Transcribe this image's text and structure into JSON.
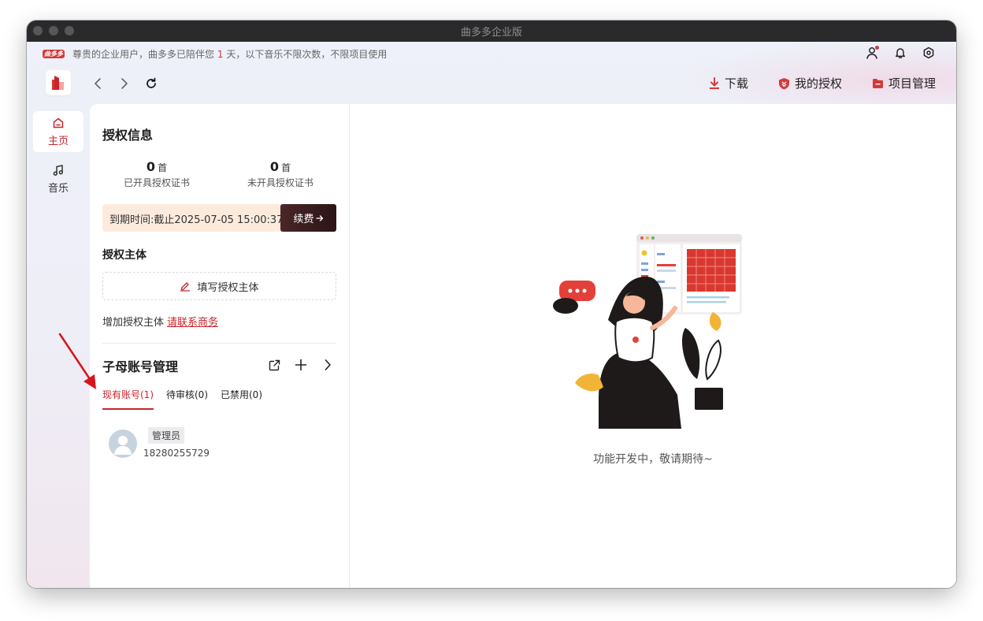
{
  "window": {
    "title": "曲多多企业版"
  },
  "notice": {
    "brand": "曲多多",
    "prefix": "尊贵的企业用户，曲多多已陪伴您",
    "days": "1",
    "suffix": "天，以下音乐不限次数，不限项目使用"
  },
  "top_icons": [
    "user-icon",
    "bell-icon",
    "settings-icon"
  ],
  "toolbar": {
    "download_label": "下载",
    "my_license_label": "我的授权",
    "project_label": "项目管理"
  },
  "sidebar": {
    "items": [
      {
        "label": "主页",
        "icon": "home-icon",
        "active": true
      },
      {
        "label": "音乐",
        "icon": "music-note-icon",
        "active": false
      }
    ]
  },
  "license_info": {
    "title": "授权信息",
    "stats": [
      {
        "value": "0",
        "unit": "首",
        "label": "已开具授权证书"
      },
      {
        "value": "0",
        "unit": "首",
        "label": "未开具授权证书"
      }
    ],
    "expiry_text": "到期时间:截止2025-07-05 15:00:37",
    "renew_label": "续费"
  },
  "license_subject": {
    "title": "授权主体",
    "fill_label": "填写授权主体",
    "add_text": "增加授权主体",
    "contact_link": "请联系商务"
  },
  "accounts": {
    "title": "子母账号管理",
    "tabs": [
      {
        "label": "现有账号(1)",
        "active": true
      },
      {
        "label": "待审核(0)",
        "active": false
      },
      {
        "label": "已禁用(0)",
        "active": false
      }
    ],
    "members": [
      {
        "role": "管理员",
        "phone": "18280255729"
      }
    ]
  },
  "main": {
    "empty_text": "功能开发中，敬请期待~"
  },
  "colors": {
    "accent": "#c8242b",
    "renew_dark": "#2b1416",
    "expiry_bg": "#fcebdd",
    "titlebar": "#2a2a2c"
  }
}
